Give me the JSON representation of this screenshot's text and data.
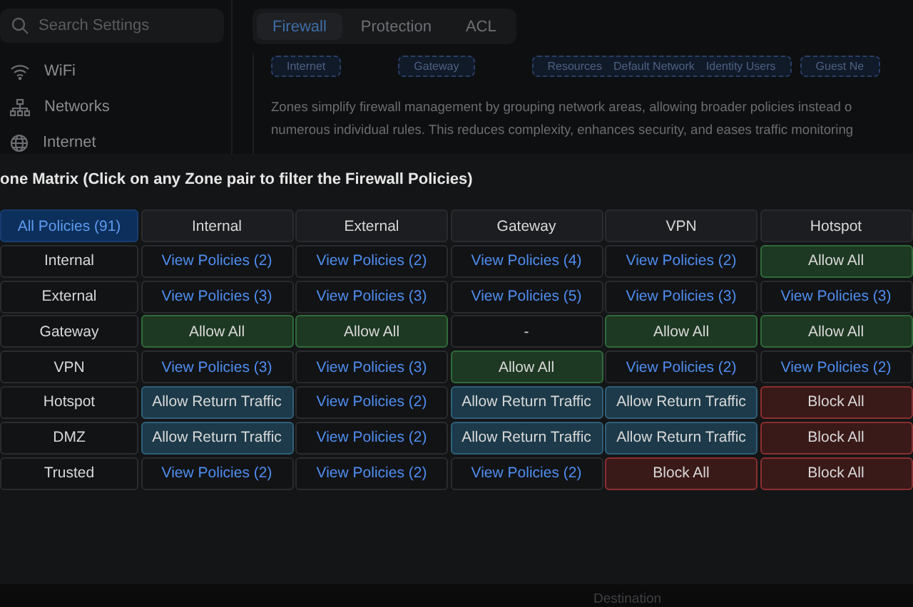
{
  "sidebar": {
    "search": {
      "placeholder": "Search Settings"
    },
    "items": [
      {
        "label": "WiFi"
      },
      {
        "label": "Networks"
      },
      {
        "label": "Internet"
      }
    ]
  },
  "tabs": [
    {
      "label": "Firewall",
      "selected": true
    },
    {
      "label": "Protection",
      "selected": false
    },
    {
      "label": "ACL",
      "selected": false
    }
  ],
  "zone_chips": [
    {
      "labels": [
        "Internet"
      ]
    },
    {
      "labels": [
        "Gateway"
      ]
    },
    {
      "labels": [
        "Resources",
        "Default Network",
        "Identity Users"
      ]
    },
    {
      "labels": [
        "Guest Ne"
      ]
    }
  ],
  "description_lines": [
    "Zones simplify firewall management by grouping network areas, allowing broader policies instead o",
    "numerous individual rules. This reduces complexity, enhances security, and eases traffic monitoring"
  ],
  "matrix": {
    "title": "one Matrix (Click on any Zone pair to filter the Firewall Policies)",
    "corner": {
      "label": "All Policies (91)",
      "selected": true
    },
    "columns": [
      "Internal",
      "External",
      "Gateway",
      "VPN",
      "Hotspot"
    ],
    "rows": [
      {
        "zone": "Internal",
        "cells": [
          {
            "kind": "link",
            "text": "View Policies (2)"
          },
          {
            "kind": "link",
            "text": "View Policies (2)"
          },
          {
            "kind": "link",
            "text": "View Policies (4)"
          },
          {
            "kind": "link",
            "text": "View Policies (2)"
          },
          {
            "kind": "allow",
            "text": "Allow All"
          }
        ]
      },
      {
        "zone": "External",
        "cells": [
          {
            "kind": "link",
            "text": "View Policies (3)"
          },
          {
            "kind": "link",
            "text": "View Policies (3)"
          },
          {
            "kind": "link",
            "text": "View Policies (5)"
          },
          {
            "kind": "link",
            "text": "View Policies (3)"
          },
          {
            "kind": "link",
            "text": "View Policies (3)"
          }
        ]
      },
      {
        "zone": "Gateway",
        "cells": [
          {
            "kind": "allow",
            "text": "Allow All"
          },
          {
            "kind": "allow",
            "text": "Allow All"
          },
          {
            "kind": "none",
            "text": "-"
          },
          {
            "kind": "allow",
            "text": "Allow All"
          },
          {
            "kind": "allow",
            "text": "Allow All"
          }
        ]
      },
      {
        "zone": "VPN",
        "cells": [
          {
            "kind": "link",
            "text": "View Policies (3)"
          },
          {
            "kind": "link",
            "text": "View Policies (3)"
          },
          {
            "kind": "allow",
            "text": "Allow All"
          },
          {
            "kind": "link",
            "text": "View Policies (2)"
          },
          {
            "kind": "link",
            "text": "View Policies (2)"
          }
        ]
      },
      {
        "zone": "Hotspot",
        "cells": [
          {
            "kind": "return",
            "text": "Allow Return Traffic"
          },
          {
            "kind": "link",
            "text": "View Policies (2)"
          },
          {
            "kind": "return",
            "text": "Allow Return Traffic"
          },
          {
            "kind": "return",
            "text": "Allow Return Traffic"
          },
          {
            "kind": "block",
            "text": "Block All"
          }
        ]
      },
      {
        "zone": "DMZ",
        "cells": [
          {
            "kind": "return",
            "text": "Allow Return Traffic"
          },
          {
            "kind": "link",
            "text": "View Policies (2)"
          },
          {
            "kind": "return",
            "text": "Allow Return Traffic"
          },
          {
            "kind": "return",
            "text": "Allow Return Traffic"
          },
          {
            "kind": "block",
            "text": "Block All"
          }
        ]
      },
      {
        "zone": "Trusted",
        "cells": [
          {
            "kind": "link",
            "text": "View Policies (2)"
          },
          {
            "kind": "link",
            "text": "View Policies (2)"
          },
          {
            "kind": "link",
            "text": "View Policies (2)"
          },
          {
            "kind": "block",
            "text": "Block All"
          },
          {
            "kind": "block",
            "text": "Block All"
          }
        ]
      }
    ]
  },
  "footer": {
    "column_label": "Destination"
  }
}
